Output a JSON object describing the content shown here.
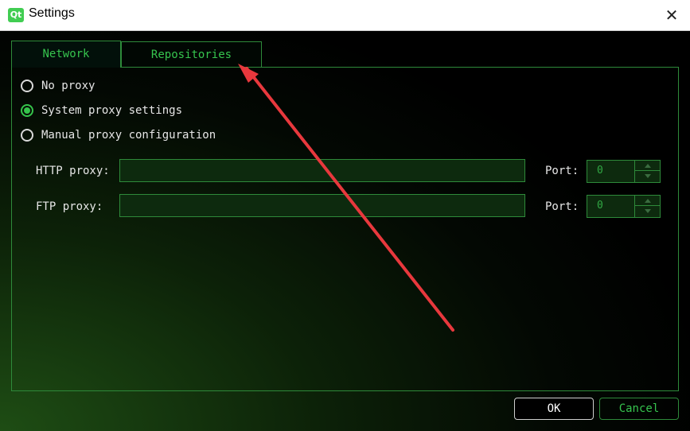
{
  "window": {
    "logo": "Qt",
    "title": "Settings",
    "close_glyph": "✕"
  },
  "tabs": [
    {
      "label": "Network",
      "active": true
    },
    {
      "label": "Repositories",
      "active": false
    }
  ],
  "proxy_options": [
    {
      "label": "No proxy",
      "checked": false
    },
    {
      "label": "System proxy settings",
      "checked": true
    },
    {
      "label": "Manual proxy configuration",
      "checked": false
    }
  ],
  "http": {
    "label": "HTTP proxy:",
    "value": "",
    "port_label": "Port:",
    "port_value": "0"
  },
  "ftp": {
    "label": "FTP proxy:",
    "value": "",
    "port_label": "Port:",
    "port_value": "0"
  },
  "buttons": {
    "ok": "OK",
    "cancel": "Cancel"
  },
  "colors": {
    "accent": "#36c44e",
    "annotation_arrow": "#e8383d",
    "background": "#000000"
  }
}
